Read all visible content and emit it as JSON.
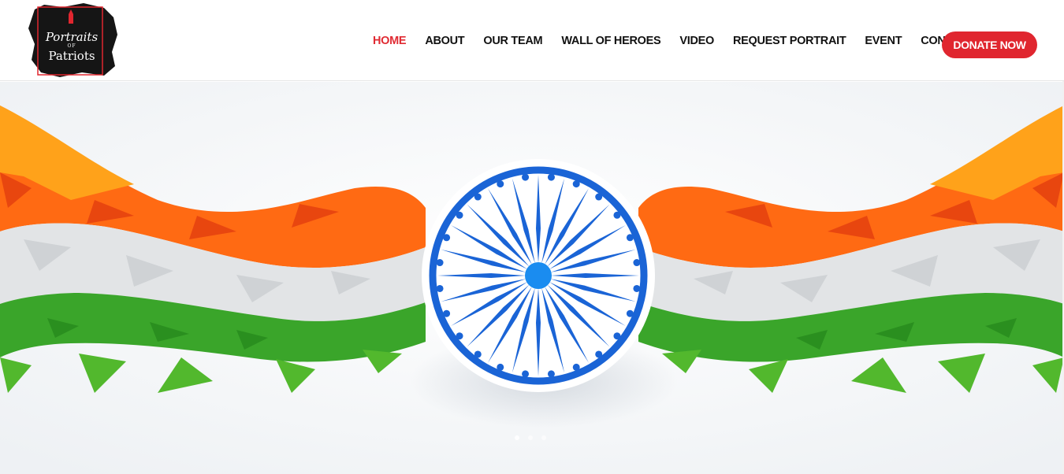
{
  "brand": {
    "logo_line1": "Portraits",
    "logo_line2": "OF",
    "logo_line3": "Patriots"
  },
  "nav": {
    "items": [
      {
        "label": "HOME",
        "active": true
      },
      {
        "label": "ABOUT",
        "active": false
      },
      {
        "label": "OUR TEAM",
        "active": false
      },
      {
        "label": "WALL OF HEROES",
        "active": false
      },
      {
        "label": "VIDEO",
        "active": false
      },
      {
        "label": "REQUEST PORTRAIT",
        "active": false
      },
      {
        "label": "EVENT",
        "active": false
      },
      {
        "label": "CONTACT",
        "active": false
      }
    ],
    "donate_label": "DONATE NOW"
  },
  "hero": {
    "image": "indian-tricolor-wave-with-ashoka-chakra",
    "slide_count": 3,
    "active_slide": 1
  },
  "colors": {
    "accent_red": "#e0262f",
    "saffron": "#ff7a1a",
    "green": "#3aa52a",
    "chakra_blue": "#1a64d6"
  }
}
